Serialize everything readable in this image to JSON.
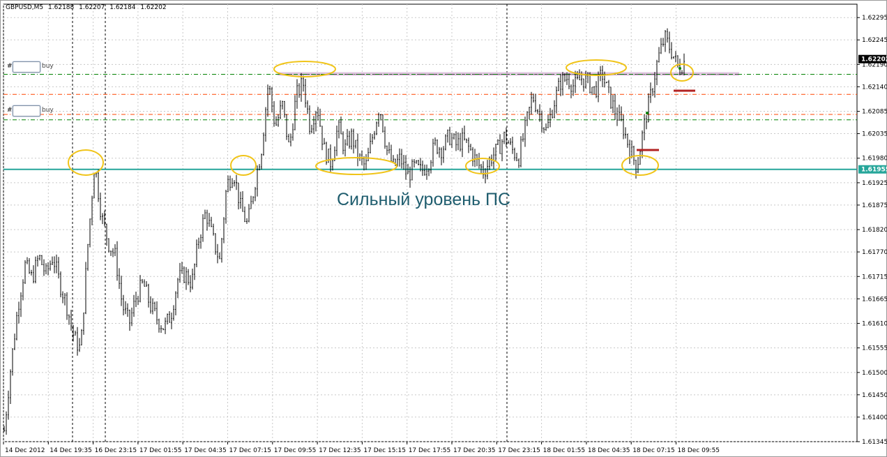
{
  "title": {
    "symbol": "GBPUSD,M5",
    "ohlc": [
      "1.62188",
      "1.62207",
      "1.62184",
      "1.62202"
    ]
  },
  "annotation": "Сильный уровень ПС",
  "trades": [
    {
      "hash": "#",
      "label": "buy"
    },
    {
      "hash": "#",
      "label": "buy"
    }
  ],
  "colors": {
    "price_bar": "#000000",
    "grid": "#c8c8c8",
    "support_line": "#26a69a",
    "resistance_line": "#d9b8d9",
    "entry_line": "#008000",
    "stop_line": "#ff4500",
    "highlight": "#f0c419",
    "stop_mark": "#b22222"
  },
  "chart_data": {
    "type": "ohlc",
    "symbol": "GBPUSD",
    "timeframe": "M5",
    "ylim": [
      1.61345,
      1.62325
    ],
    "y_ticks": [
      "1.62295",
      "1.62245",
      "1.62190",
      "1.62140",
      "1.62085",
      "1.62035",
      "1.61980",
      "1.61925",
      "1.61875",
      "1.61820",
      "1.61770",
      "1.61715",
      "1.61665",
      "1.61610",
      "1.61555",
      "1.61500",
      "1.61450",
      "1.61400",
      "1.61345"
    ],
    "x_ticks": [
      "14 Dec 2012",
      "14 Dec 19:35",
      "16 Dec 23:15",
      "17 Dec 01:55",
      "17 Dec 04:35",
      "17 Dec 07:15",
      "17 Dec 09:55",
      "17 Dec 12:35",
      "17 Dec 15:15",
      "17 Dec 17:55",
      "17 Dec 20:35",
      "17 Dec 23:15",
      "18 Dec 01:55",
      "18 Dec 04:35",
      "18 Dec 07:15",
      "18 Dec 09:55"
    ],
    "current_price": "1.62202",
    "support_level": "1.61955",
    "resistance_level": 1.62168,
    "entry_levels": [
      1.62168,
      1.62066
    ],
    "stop_levels": [
      1.62123,
      1.62078
    ],
    "path": [
      [
        0,
        1.6137
      ],
      [
        1,
        1.6152
      ],
      [
        2,
        1.6165
      ],
      [
        3,
        1.6174
      ],
      [
        4,
        1.6171
      ],
      [
        5,
        1.6176
      ],
      [
        6,
        1.6172
      ],
      [
        7,
        1.6176
      ],
      [
        8,
        1.617
      ],
      [
        9,
        1.6165
      ],
      [
        10,
        1.6158
      ],
      [
        11,
        1.6155
      ],
      [
        12,
        1.6178
      ],
      [
        13,
        1.6197
      ],
      [
        14,
        1.6185
      ],
      [
        15,
        1.6179
      ],
      [
        16,
        1.6176
      ],
      [
        17,
        1.6165
      ],
      [
        18,
        1.6161
      ],
      [
        19,
        1.6167
      ],
      [
        20,
        1.617
      ],
      [
        21,
        1.6165
      ],
      [
        22,
        1.6162
      ],
      [
        23,
        1.616
      ],
      [
        24,
        1.6163
      ],
      [
        25,
        1.6171
      ],
      [
        26,
        1.6172
      ],
      [
        27,
        1.617
      ],
      [
        28,
        1.618
      ],
      [
        29,
        1.6186
      ],
      [
        30,
        1.618
      ],
      [
        31,
        1.6175
      ],
      [
        32,
        1.6192
      ],
      [
        33,
        1.6195
      ],
      [
        34,
        1.6187
      ],
      [
        35,
        1.6183
      ],
      [
        36,
        1.6192
      ],
      [
        37,
        1.62
      ],
      [
        38,
        1.6215
      ],
      [
        39,
        1.6205
      ],
      [
        40,
        1.621
      ],
      [
        41,
        1.62
      ],
      [
        42,
        1.6212
      ],
      [
        43,
        1.6215
      ],
      [
        44,
        1.6205
      ],
      [
        45,
        1.621
      ],
      [
        46,
        1.62
      ],
      [
        47,
        1.6197
      ],
      [
        48,
        1.6205
      ],
      [
        49,
        1.62
      ],
      [
        50,
        1.6203
      ],
      [
        51,
        1.6198
      ],
      [
        52,
        1.6196
      ],
      [
        53,
        1.6203
      ],
      [
        54,
        1.621
      ],
      [
        55,
        1.62
      ],
      [
        56,
        1.6196
      ],
      [
        57,
        1.6198
      ],
      [
        58,
        1.6194
      ],
      [
        59,
        1.6196
      ],
      [
        60,
        1.6195
      ],
      [
        61,
        1.6197
      ],
      [
        62,
        1.6201
      ],
      [
        63,
        1.62
      ],
      [
        64,
        1.6203
      ],
      [
        65,
        1.6201
      ],
      [
        66,
        1.6202
      ],
      [
        67,
        1.62
      ],
      [
        68,
        1.6197
      ],
      [
        69,
        1.6195
      ],
      [
        70,
        1.6198
      ],
      [
        71,
        1.62
      ],
      [
        72,
        1.6203
      ],
      [
        73,
        1.62
      ],
      [
        74,
        1.6198
      ],
      [
        75,
        1.6205
      ],
      [
        76,
        1.6212
      ],
      [
        77,
        1.6208
      ],
      [
        78,
        1.6204
      ],
      [
        79,
        1.621
      ],
      [
        80,
        1.6215
      ],
      [
        81,
        1.6216
      ],
      [
        82,
        1.6214
      ],
      [
        83,
        1.6216
      ],
      [
        84,
        1.6215
      ],
      [
        85,
        1.6213
      ],
      [
        86,
        1.6217
      ],
      [
        87,
        1.6212
      ],
      [
        88,
        1.6208
      ],
      [
        89,
        1.6205
      ],
      [
        90,
        1.62
      ],
      [
        91,
        1.6196
      ],
      [
        92,
        1.6205
      ],
      [
        93,
        1.6212
      ],
      [
        94,
        1.622
      ],
      [
        95,
        1.6225
      ],
      [
        96,
        1.6222
      ],
      [
        97,
        1.6218
      ],
      [
        98,
        1.622
      ]
    ]
  }
}
